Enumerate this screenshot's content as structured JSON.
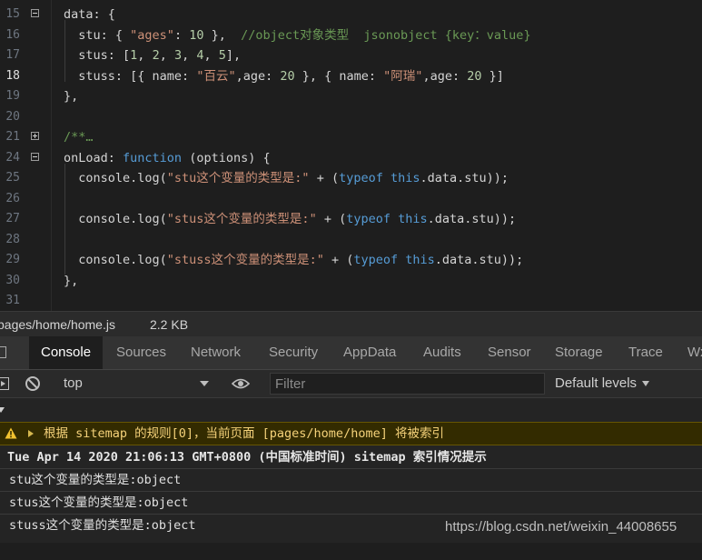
{
  "editor": {
    "line_numbers": [
      "15",
      "16",
      "17",
      "18",
      "19",
      "20",
      "21",
      "24",
      "25",
      "26",
      "27",
      "28",
      "29",
      "30",
      "31"
    ],
    "lines": [
      [
        {
          "t": "data: {",
          "c": ""
        }
      ],
      [
        {
          "t": "  stu: { ",
          "c": ""
        },
        {
          "t": "\"ages\"",
          "c": "s"
        },
        {
          "t": ": ",
          "c": ""
        },
        {
          "t": "10",
          "c": "n"
        },
        {
          "t": " },  ",
          "c": ""
        },
        {
          "t": "//object对象类型  jsonobject {key：value}",
          "c": "c"
        }
      ],
      [
        {
          "t": "  stus: [",
          "c": ""
        },
        {
          "t": "1",
          "c": "n"
        },
        {
          "t": ", ",
          "c": ""
        },
        {
          "t": "2",
          "c": "n"
        },
        {
          "t": ", ",
          "c": ""
        },
        {
          "t": "3",
          "c": "n"
        },
        {
          "t": ", ",
          "c": ""
        },
        {
          "t": "4",
          "c": "n"
        },
        {
          "t": ", ",
          "c": ""
        },
        {
          "t": "5",
          "c": "n"
        },
        {
          "t": "],",
          "c": ""
        }
      ],
      [
        {
          "t": "  stuss: [{ name: ",
          "c": ""
        },
        {
          "t": "\"百云\"",
          "c": "s"
        },
        {
          "t": ",age: ",
          "c": ""
        },
        {
          "t": "20",
          "c": "n"
        },
        {
          "t": " }, { name: ",
          "c": ""
        },
        {
          "t": "\"阿瑞\"",
          "c": "s"
        },
        {
          "t": ",age: ",
          "c": ""
        },
        {
          "t": "20",
          "c": "n"
        },
        {
          "t": " }]",
          "c": ""
        }
      ],
      [
        {
          "t": "},",
          "c": ""
        }
      ],
      [
        {
          "t": "",
          "c": ""
        }
      ],
      [
        {
          "t": "/**…",
          "c": "c"
        }
      ],
      [
        {
          "t": "onLoad: ",
          "c": ""
        },
        {
          "t": "function",
          "c": "k"
        },
        {
          "t": " (options) {",
          "c": ""
        }
      ],
      [
        {
          "t": "  console.log(",
          "c": ""
        },
        {
          "t": "\"stu这个变量的类型是:\"",
          "c": "s"
        },
        {
          "t": " + (",
          "c": ""
        },
        {
          "t": "typeof",
          "c": "k"
        },
        {
          "t": " ",
          "c": ""
        },
        {
          "t": "this",
          "c": "k"
        },
        {
          "t": ".data.stu));",
          "c": ""
        }
      ],
      [
        {
          "t": "",
          "c": ""
        }
      ],
      [
        {
          "t": "  console.log(",
          "c": ""
        },
        {
          "t": "\"stus这个变量的类型是:\"",
          "c": "s"
        },
        {
          "t": " + (",
          "c": ""
        },
        {
          "t": "typeof",
          "c": "k"
        },
        {
          "t": " ",
          "c": ""
        },
        {
          "t": "this",
          "c": "k"
        },
        {
          "t": ".data.stu));",
          "c": ""
        }
      ],
      [
        {
          "t": "",
          "c": ""
        }
      ],
      [
        {
          "t": "  console.log(",
          "c": ""
        },
        {
          "t": "\"stuss这个变量的类型是:\"",
          "c": "s"
        },
        {
          "t": " + (",
          "c": ""
        },
        {
          "t": "typeof",
          "c": "k"
        },
        {
          "t": " ",
          "c": ""
        },
        {
          "t": "this",
          "c": "k"
        },
        {
          "t": ".data.stu));",
          "c": ""
        }
      ],
      [
        {
          "t": "},",
          "c": ""
        }
      ],
      [
        {
          "t": "",
          "c": ""
        }
      ]
    ],
    "active_line": "18",
    "fold_markers": {
      "15": "minus",
      "21": "plus",
      "24": "minus"
    },
    "colors": {
      "keyword": "#569cd6",
      "string": "#ce9178",
      "number": "#b5cea8",
      "comment": "#6a9955"
    }
  },
  "file": {
    "name": "pages/home/home.js",
    "size": "2.2 KB"
  },
  "tabs": [
    {
      "label": "Console",
      "active": true
    },
    {
      "label": "Sources"
    },
    {
      "label": "Network"
    },
    {
      "label": "Security"
    },
    {
      "label": "AppData"
    },
    {
      "label": "Audits"
    },
    {
      "label": "Sensor"
    },
    {
      "label": "Storage"
    },
    {
      "label": "Trace"
    },
    {
      "label": "Wx"
    }
  ],
  "toolbar": {
    "context": "top",
    "filter_placeholder": "Filter",
    "levels": "Default levels"
  },
  "console": {
    "group_header": "Tue Apr 14 2020 21:06:13 GMT+0800 (中国标准时间) sitemap 索引情况提示",
    "warning": "根据 sitemap 的规则[0]，当前页面 [pages/home/home] 将被索引",
    "logs": [
      "stu这个变量的类型是:object",
      "stus这个变量的类型是:object",
      "stuss这个变量的类型是:object"
    ],
    "warning_color": "#f5d27a"
  },
  "watermark": "https://blog.csdn.net/weixin_44008655"
}
